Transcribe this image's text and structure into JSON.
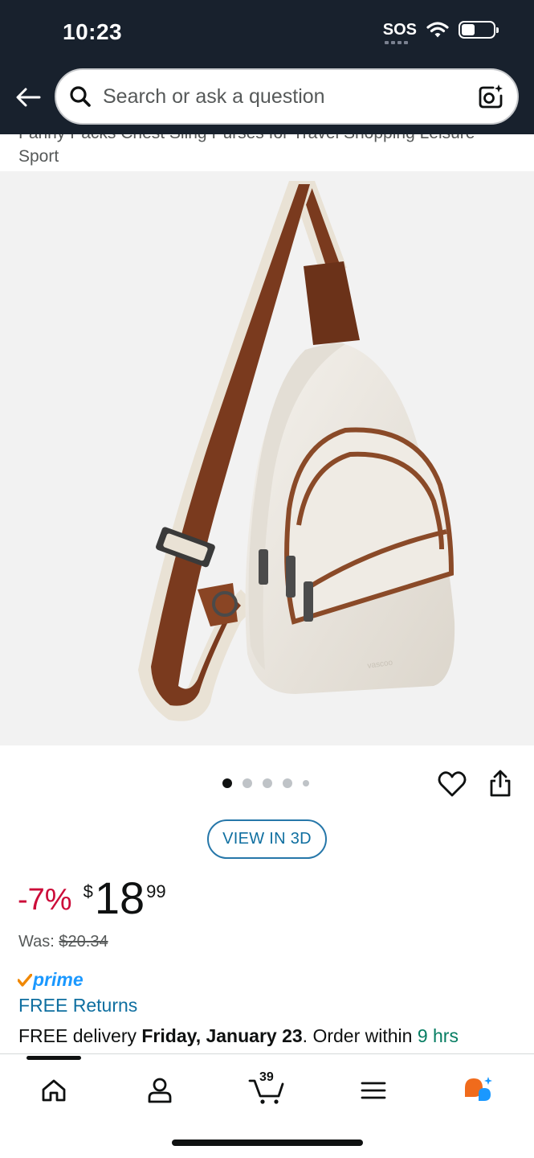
{
  "status_bar": {
    "time": "10:23",
    "sos": "SOS",
    "icons": [
      "wifi-icon",
      "battery-icon"
    ]
  },
  "search": {
    "placeholder": "Search or ask a question",
    "icons": [
      "back-arrow-icon",
      "search-icon",
      "camera-lens-icon"
    ]
  },
  "product": {
    "title_visible": "Fanny Packs Chest Sling Purses for Travel Shopping Leisure Sport",
    "image_count": 5,
    "active_image": 1,
    "view_3d_label": "VIEW IN 3D",
    "discount": "-7%",
    "price_symbol": "$",
    "price_whole": "18",
    "price_fraction": "99",
    "was_label": "Was:",
    "was_price": "$20.34",
    "prime_label": "prime",
    "free_returns": "FREE Returns",
    "delivery_prefix": "FREE delivery ",
    "delivery_date": "Friday, January 23",
    "delivery_middle": ". Order within ",
    "delivery_time": "9 hrs"
  },
  "bottom_nav": {
    "items": [
      "home-icon",
      "account-icon",
      "cart-icon",
      "menu-icon",
      "rufus-icon"
    ],
    "cart_count": "39"
  },
  "colors": {
    "header_bg": "#18212d",
    "discount_red": "#cc0c39",
    "link_blue": "#0f6fa0",
    "prime_blue": "#1a98ff",
    "delivery_green": "#067d62",
    "prime_check_orange": "#f08804",
    "bag_cream": "#ede9e1",
    "strap_brown": "#7a3a1e"
  }
}
